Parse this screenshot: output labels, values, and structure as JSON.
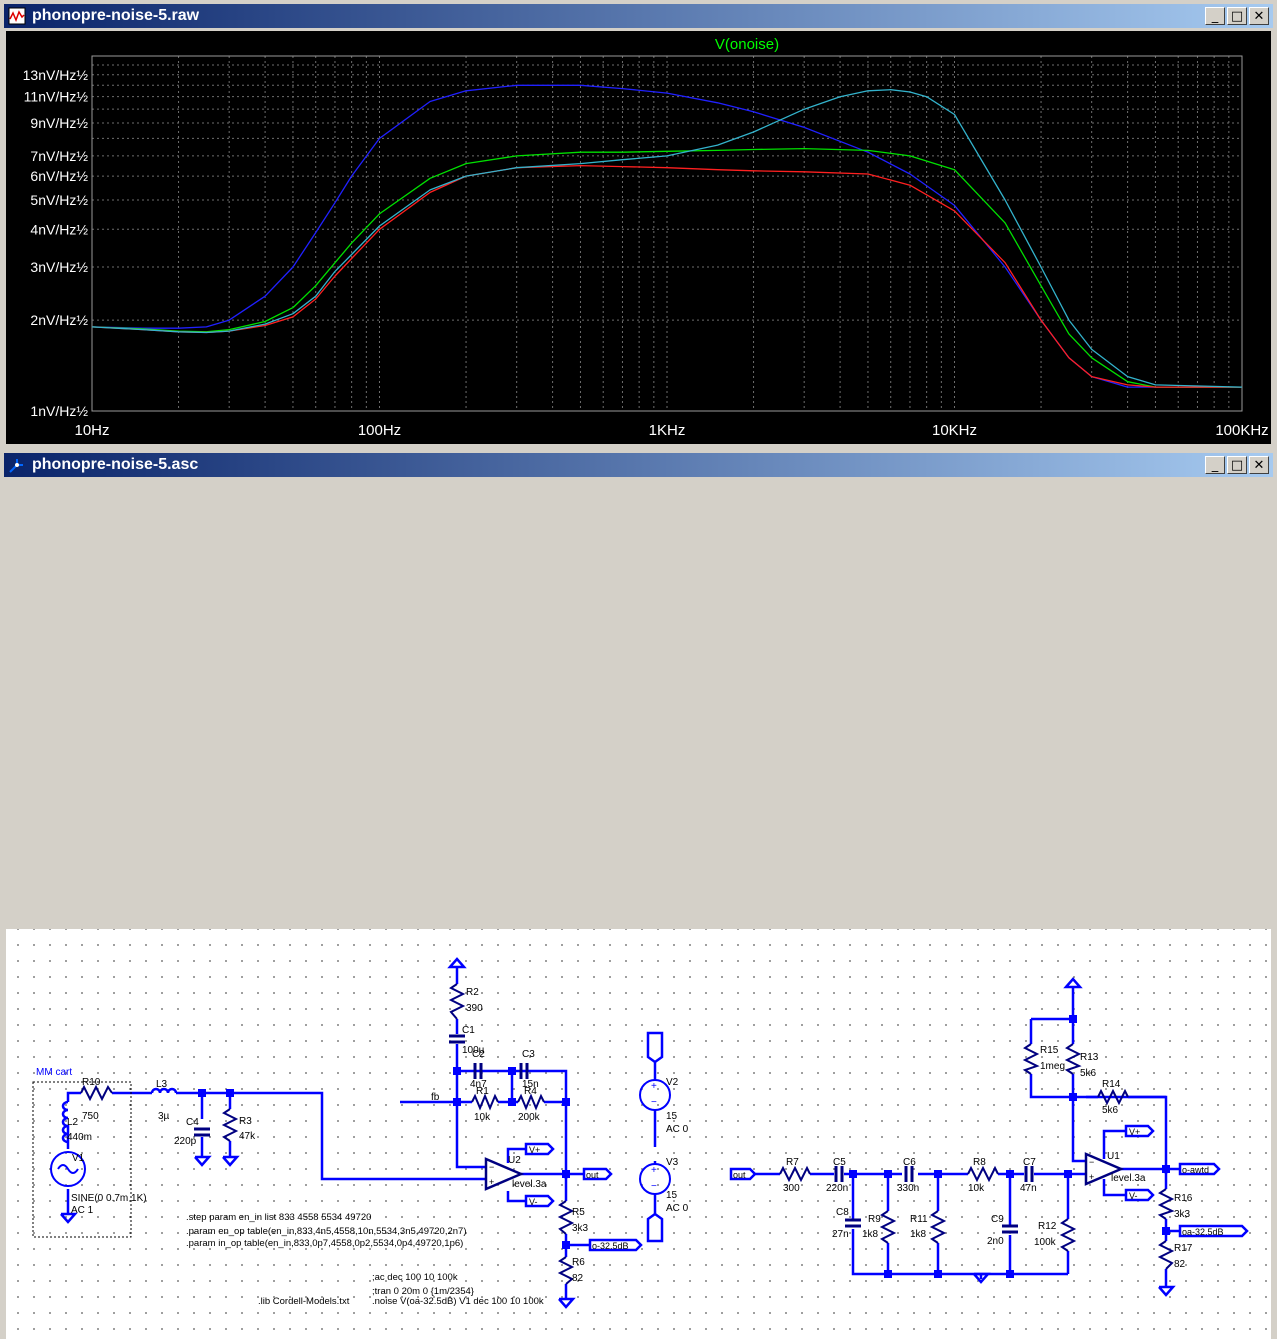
{
  "waveform_window": {
    "title": "phonopre-noise-5.raw",
    "buttons": {
      "minimize": "_",
      "maximize": "□",
      "close": "✕"
    }
  },
  "schematic_window": {
    "title": "phonopre-noise-5.asc",
    "buttons": {
      "minimize": "_",
      "maximize": "□",
      "close": "✕"
    }
  },
  "chart_data": {
    "type": "line",
    "title": "V(onoise)",
    "xscale": "log",
    "yscale": "log",
    "xlim": [
      10,
      100000
    ],
    "ylim": [
      1,
      15
    ],
    "grid": true,
    "x_tick_labels": [
      "10Hz",
      "100Hz",
      "1KHz",
      "10KHz",
      "100KHz"
    ],
    "y_tick_labels": [
      "1nV/Hz½",
      "2nV/Hz½",
      "3nV/Hz½",
      "4nV/Hz½",
      "5nV/Hz½",
      "6nV/Hz½",
      "7nV/Hz½",
      "9nV/Hz½",
      "11nV/Hz½",
      "13nV/Hz½"
    ],
    "colors": {
      "title": "#00ff00",
      "axis_text": "#ffffff",
      "grid": "#6e6e6e"
    },
    "series": [
      {
        "color": "#2020ff",
        "x": [
          10,
          15,
          20,
          25,
          30,
          40,
          50,
          60,
          70,
          80,
          100,
          150,
          200,
          300,
          500,
          700,
          1000,
          1500,
          2000,
          3000,
          5000,
          7000,
          10000,
          15000,
          20000,
          25000,
          30000,
          40000,
          50000,
          100000
        ],
        "y": [
          1.9,
          1.88,
          1.88,
          1.9,
          2.0,
          2.4,
          3.0,
          3.9,
          4.9,
          6.0,
          8.0,
          10.6,
          11.5,
          12.0,
          12.0,
          11.7,
          11.3,
          10.5,
          9.8,
          8.7,
          7.2,
          6.1,
          4.8,
          3.0,
          2.0,
          1.5,
          1.3,
          1.2,
          1.2,
          1.2
        ]
      },
      {
        "color": "#00e000",
        "x": [
          10,
          15,
          20,
          25,
          30,
          40,
          50,
          60,
          70,
          80,
          100,
          150,
          200,
          300,
          500,
          700,
          1000,
          1500,
          2000,
          3000,
          5000,
          7000,
          10000,
          15000,
          20000,
          25000,
          30000,
          40000,
          50000,
          100000
        ],
        "y": [
          1.9,
          1.87,
          1.84,
          1.83,
          1.86,
          1.98,
          2.2,
          2.6,
          3.1,
          3.6,
          4.5,
          5.9,
          6.6,
          7.0,
          7.2,
          7.2,
          7.25,
          7.3,
          7.35,
          7.4,
          7.3,
          7.0,
          6.3,
          4.2,
          2.6,
          1.8,
          1.5,
          1.25,
          1.2,
          1.2
        ]
      },
      {
        "color": "#ff2020",
        "x": [
          10,
          15,
          20,
          25,
          30,
          40,
          50,
          60,
          70,
          80,
          100,
          150,
          200,
          300,
          500,
          700,
          1000,
          1500,
          2000,
          3000,
          5000,
          7000,
          10000,
          15000,
          20000,
          25000,
          30000,
          40000,
          50000,
          100000
        ],
        "y": [
          1.9,
          1.86,
          1.83,
          1.82,
          1.84,
          1.92,
          2.05,
          2.35,
          2.8,
          3.2,
          4.0,
          5.3,
          6.0,
          6.4,
          6.5,
          6.45,
          6.4,
          6.3,
          6.25,
          6.2,
          6.1,
          5.6,
          4.6,
          3.1,
          2.0,
          1.5,
          1.3,
          1.22,
          1.2,
          1.2
        ]
      },
      {
        "color": "#33b3cc",
        "x": [
          10,
          15,
          20,
          25,
          30,
          40,
          50,
          60,
          70,
          80,
          100,
          150,
          200,
          300,
          500,
          700,
          1000,
          1500,
          2000,
          3000,
          4000,
          5000,
          6000,
          7000,
          8000,
          10000,
          15000,
          20000,
          25000,
          30000,
          40000,
          50000,
          100000
        ],
        "y": [
          1.9,
          1.86,
          1.83,
          1.82,
          1.84,
          1.94,
          2.1,
          2.4,
          2.9,
          3.3,
          4.1,
          5.4,
          6.0,
          6.4,
          6.6,
          6.8,
          7.0,
          7.6,
          8.4,
          10.0,
          11.0,
          11.5,
          11.6,
          11.4,
          11.0,
          9.6,
          5.0,
          3.0,
          2.0,
          1.6,
          1.3,
          1.22,
          1.2
        ]
      }
    ]
  },
  "schematic": {
    "components": {
      "mm_cart": "MM cart",
      "r10": "R10",
      "r10_val": "750",
      "l2": "L2",
      "l2_val": "440m",
      "v1": "V1",
      "v1_val": "SINE(0 0.7m 1K)",
      "v1_ac": "AC 1",
      "l3": "L3",
      "l3_val": "3µ",
      "c4": "C4",
      "c4_val": "220p",
      "r3": "R3",
      "r3_val": "47k",
      "r2": "R2",
      "r2_val": "390",
      "c1": "C1",
      "c1_val": "100µ",
      "c2": "C2",
      "c2_val": "4n7",
      "r1": "R1",
      "r1_val": "10k",
      "c3": "C3",
      "c3_val": "15n",
      "r4": "R4",
      "r4_val": "200k",
      "fb": "fb",
      "u2": "U2",
      "u2_val": "level.3a",
      "vplus": "V+",
      "vminus": "V-",
      "out": "out",
      "r5": "R5",
      "r5_val": "3k3",
      "r6": "R6",
      "r6_val": "82",
      "oa325": "o-32.5dB",
      "v2": "V2",
      "v2_val": "15",
      "v2_ac": "AC 0",
      "v3": "V3",
      "v3_val": "15",
      "v3_ac": "AC 0",
      "r7": "R7",
      "r7_val": "300",
      "c5": "C5",
      "c5_val": "220n",
      "c8": "C8",
      "c8_val": "27n",
      "r9": "R9",
      "r9_val": "1k8",
      "c6": "C6",
      "c6_val": "330n",
      "r11": "R11",
      "r11_val": "1k8",
      "r8": "R8",
      "r8_val": "10k",
      "c9": "C9",
      "c9_val": "2n0",
      "c7": "C7",
      "c7_val": "47n",
      "r12": "R12",
      "r12_val": "100k",
      "r15": "R15",
      "r15_val": "1meg",
      "r13": "R13",
      "r13_val": "5k6",
      "r14": "R14",
      "r14_val": "5k6",
      "u1": "U1",
      "u1_val": "level.3a",
      "oawtd": "o-awtd",
      "r16": "R16",
      "r16_val": "3k3",
      "r17": "R17",
      "r17_val": "82",
      "oa325b": "oa-32.5dB"
    },
    "directives": [
      ".step param en_in list 833 4558 5534 49720",
      ".param en_op table(en_in,833,4n5,4558,10n,5534,3n5,49720,2n7)",
      ".param in_op table(en_in,833,0p7,4558,0p2,5534,0p4,49720,1p6)",
      ";ac dec 100 10 100k",
      ";tran 0 20m 0 {1m/2354}",
      ".lib Cordell-Models.txt",
      ".noise V(oa-32.5dB) V1 dec 100 10 100k"
    ]
  }
}
